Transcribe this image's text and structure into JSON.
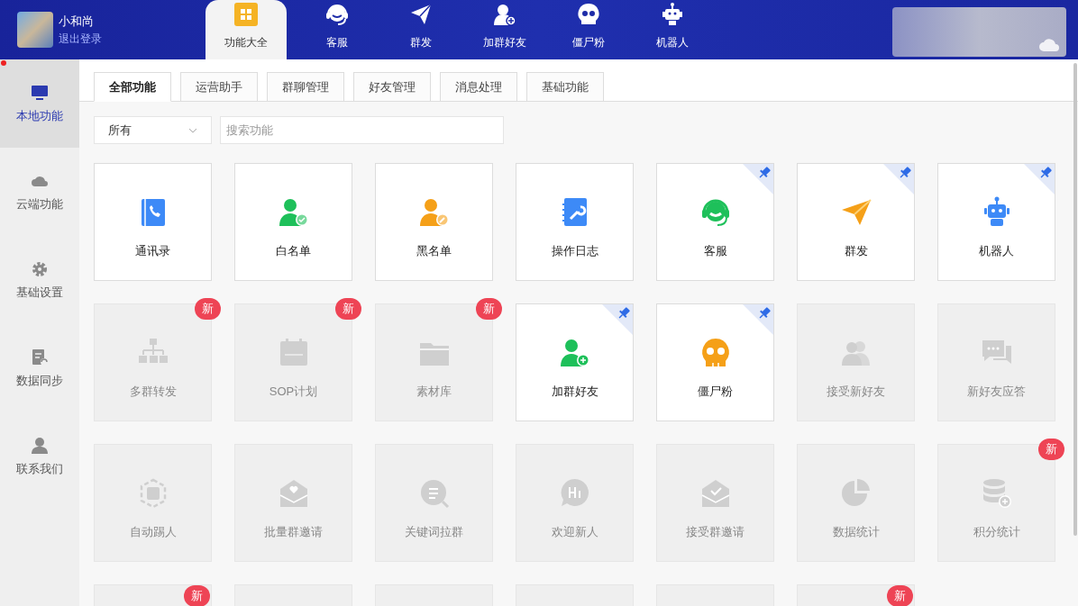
{
  "user": {
    "name": "小和尚",
    "logout": "退出登录"
  },
  "nav": [
    {
      "label": "功能大全",
      "selected": true
    },
    {
      "label": "客服",
      "selected": false
    },
    {
      "label": "群发",
      "selected": false
    },
    {
      "label": "加群好友",
      "selected": false
    },
    {
      "label": "僵尸粉",
      "selected": false
    },
    {
      "label": "机器人",
      "selected": false
    }
  ],
  "sidebar": {
    "items": [
      {
        "label": "本地功能",
        "selected": true
      },
      {
        "label": "云端功能",
        "selected": false
      },
      {
        "label": "基础设置",
        "selected": false
      },
      {
        "label": "数据同步",
        "selected": false
      },
      {
        "label": "联系我们",
        "selected": false
      }
    ]
  },
  "tabs": [
    {
      "label": "全部功能",
      "selected": true
    },
    {
      "label": "运营助手",
      "selected": false
    },
    {
      "label": "群聊管理",
      "selected": false
    },
    {
      "label": "好友管理",
      "selected": false
    },
    {
      "label": "消息处理",
      "selected": false
    },
    {
      "label": "基础功能",
      "selected": false
    }
  ],
  "filter": {
    "value": "所有",
    "search_placeholder": "搜索功能"
  },
  "cards": [
    {
      "label": "通讯录",
      "enabled": true,
      "pinned": false
    },
    {
      "label": "白名单",
      "enabled": true,
      "pinned": false
    },
    {
      "label": "黑名单",
      "enabled": true,
      "pinned": false
    },
    {
      "label": "操作日志",
      "enabled": true,
      "pinned": false
    },
    {
      "label": "客服",
      "enabled": true,
      "pinned": true
    },
    {
      "label": "群发",
      "enabled": true,
      "pinned": true
    },
    {
      "label": "机器人",
      "enabled": true,
      "pinned": true
    },
    {
      "label": "多群转发",
      "enabled": false,
      "pinned": false,
      "badge": "新"
    },
    {
      "label": "SOP计划",
      "enabled": false,
      "pinned": false,
      "badge": "新"
    },
    {
      "label": "素材库",
      "enabled": false,
      "pinned": false,
      "badge": "新"
    },
    {
      "label": "加群好友",
      "enabled": true,
      "pinned": true
    },
    {
      "label": "僵尸粉",
      "enabled": true,
      "pinned": true
    },
    {
      "label": "接受新好友",
      "enabled": false,
      "pinned": false
    },
    {
      "label": "新好友应答",
      "enabled": false,
      "pinned": false
    },
    {
      "label": "自动踢人",
      "enabled": false,
      "pinned": false
    },
    {
      "label": "批量群邀请",
      "enabled": false,
      "pinned": false
    },
    {
      "label": "关键词拉群",
      "enabled": false,
      "pinned": false
    },
    {
      "label": "欢迎新人",
      "enabled": false,
      "pinned": false
    },
    {
      "label": "接受群邀请",
      "enabled": false,
      "pinned": false
    },
    {
      "label": "数据统计",
      "enabled": false,
      "pinned": false
    },
    {
      "label": "积分统计",
      "enabled": false,
      "pinned": false,
      "badge": "新"
    },
    {
      "enabled": false,
      "badge": "新"
    },
    {
      "enabled": false
    },
    {
      "enabled": false
    },
    {
      "enabled": false
    },
    {
      "enabled": false
    },
    {
      "enabled": false,
      "badge": "新"
    }
  ]
}
